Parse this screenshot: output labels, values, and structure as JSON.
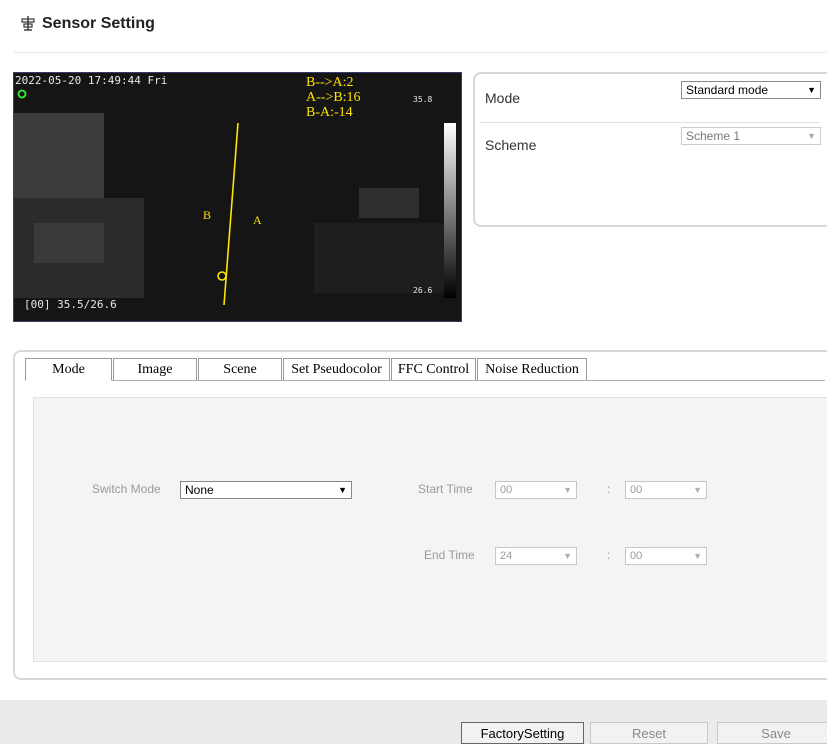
{
  "header": {
    "title": "Sensor Setting",
    "icon": "sensor-icon"
  },
  "video": {
    "timestamp": "2022-05-20 17:49:44 Fri",
    "counts": [
      "B-->A:2",
      "A-->B:16",
      "B-A:-14"
    ],
    "scale_max": "35.8",
    "scale_min": "26.6",
    "reading": "[00] 35.5/26.6",
    "side_b": "B",
    "side_a": "A"
  },
  "mode_panel": {
    "mode_label": "Mode",
    "mode_value": "Standard mode",
    "scheme_label": "Scheme",
    "scheme_value": "Scheme 1"
  },
  "tabs": [
    {
      "label": "Mode"
    },
    {
      "label": "Image"
    },
    {
      "label": "Scene"
    },
    {
      "label": "Set Pseudocolor"
    },
    {
      "label": "FFC Control"
    },
    {
      "label": "Noise Reduction"
    }
  ],
  "mode_tab": {
    "switch_mode_label": "Switch Mode",
    "switch_mode_value": "None",
    "start_time_label": "Start Time",
    "start_hour": "00",
    "start_minute": "00",
    "end_time_label": "End Time",
    "end_hour": "24",
    "end_minute": "00",
    "colon": ":"
  },
  "footer": {
    "factory_label": "FactorySetting",
    "reset_label": "Reset",
    "save_label": "Save"
  },
  "colors": {
    "overlay_yellow": "#ffe400",
    "video_border": "#3a3a6a"
  }
}
